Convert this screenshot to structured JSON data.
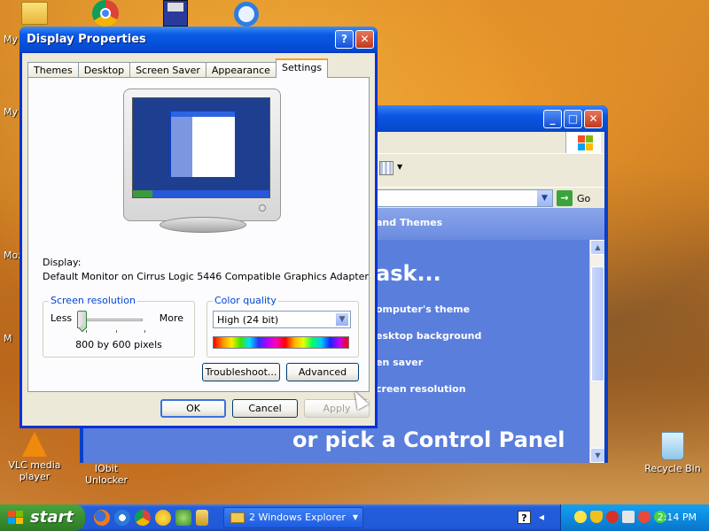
{
  "desktop": {
    "icons": [
      {
        "label": "VLC media player",
        "icon": "vlc-cone-icon"
      },
      {
        "label": "IObit Unlocker",
        "icon": "iobit-unlocker-icon"
      },
      {
        "label": "Recycle Bin",
        "icon": "recycle-bin-icon"
      }
    ],
    "edge_labels": [
      "My",
      "My",
      "Moz",
      "M"
    ],
    "top_icons": [
      "folder-icon",
      "chrome-icon",
      "floppy-icon",
      "internet-explorer-icon"
    ]
  },
  "control_panel": {
    "go_label": "Go",
    "header": "and Themes",
    "task_title": "ask...",
    "tasks": [
      "omputer's theme",
      "esktop background",
      "en saver",
      "creen resolution"
    ],
    "pick_text": "or pick a Control Panel"
  },
  "dialog": {
    "title": "Display Properties",
    "tabs": [
      "Themes",
      "Desktop",
      "Screen Saver",
      "Appearance",
      "Settings"
    ],
    "active_tab": "Settings",
    "display_label": "Display:",
    "display_value": "Default Monitor on Cirrus Logic 5446 Compatible Graphics Adapter",
    "resolution": {
      "legend": "Screen resolution",
      "less": "Less",
      "more": "More",
      "value": "800 by 600 pixels",
      "slider_position": 0
    },
    "color_quality": {
      "legend": "Color quality",
      "selected": "High (24 bit)"
    },
    "buttons": {
      "troubleshoot": "Troubleshoot...",
      "advanced": "Advanced",
      "ok": "OK",
      "cancel": "Cancel",
      "apply": "Apply"
    }
  },
  "taskbar": {
    "start_label": "start",
    "quick_launch": [
      "firefox-icon",
      "ccleaner-icon",
      "chrome-icon",
      "messenger-icon",
      "joystick-icon",
      "lock-icon"
    ],
    "task": "2 Windows Explorer",
    "tray_icons": [
      "help-icon",
      "speaker-icon",
      "smiley-icon",
      "shield-icon",
      "security-icon",
      "network-icon",
      "antivirus-icon",
      "sync-icon"
    ],
    "clock": "2:14 PM"
  },
  "colors": {
    "xp_blue": "#0a56e3",
    "dialog_face": "#ece9d8",
    "tab_accent": "#f5a11c",
    "start_green": "#3a8f30",
    "tray_blue": "#0d8ce0"
  }
}
